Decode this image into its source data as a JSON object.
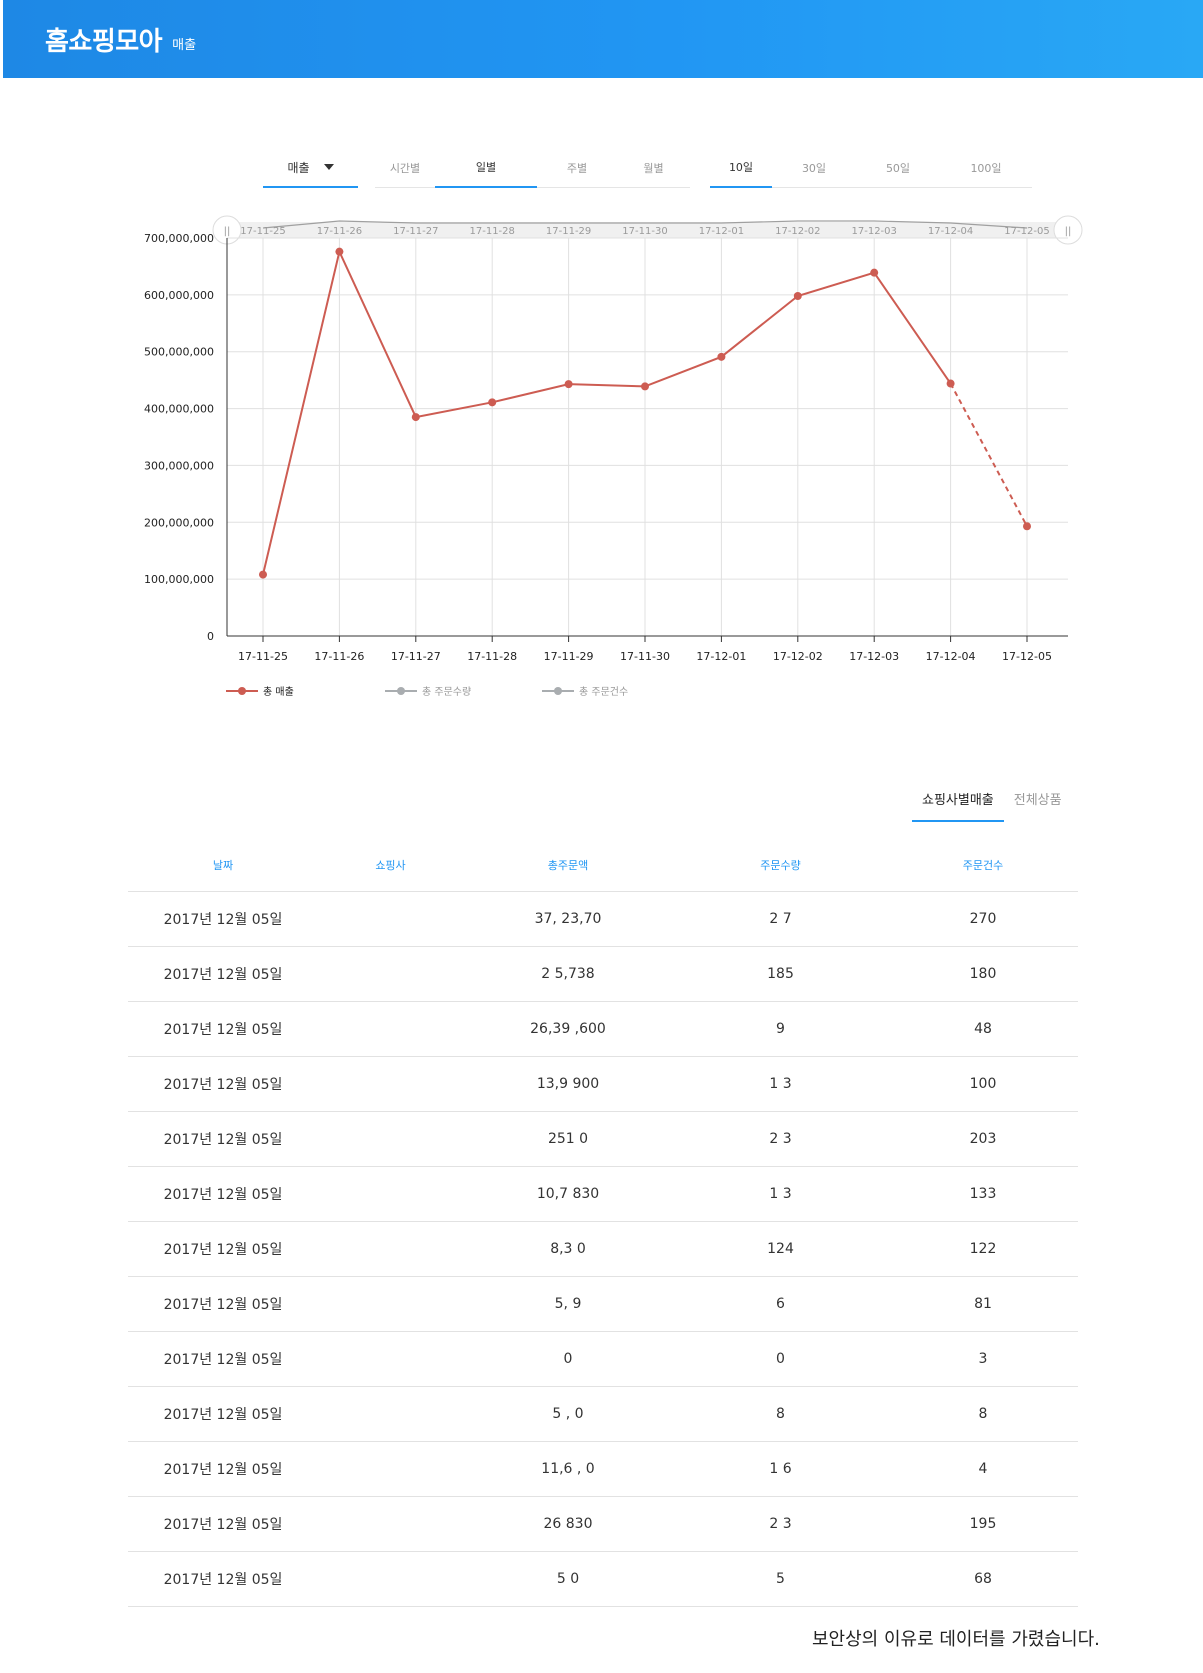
{
  "header": {
    "title": "홈쇼핑모아",
    "subtitle": "매출"
  },
  "filters": {
    "metric": "매출",
    "period_options": [
      {
        "label": "시간별",
        "active": false
      },
      {
        "label": "일별",
        "active": true
      },
      {
        "label": "주별",
        "active": false
      },
      {
        "label": "월별",
        "active": false
      }
    ],
    "range_options": [
      {
        "label": "10일",
        "active": true
      },
      {
        "label": "30일",
        "active": false
      },
      {
        "label": "50일",
        "active": false
      },
      {
        "label": "100일",
        "active": false
      }
    ]
  },
  "chart_data": {
    "type": "line",
    "categories": [
      "17-11-25",
      "17-11-26",
      "17-11-27",
      "17-11-28",
      "17-11-29",
      "17-11-30",
      "17-12-01",
      "17-12-02",
      "17-12-03",
      "17-12-04",
      "17-12-05"
    ],
    "series": [
      {
        "name": "총 매출",
        "values": [
          108000000,
          676000000,
          385000000,
          411000000,
          443000000,
          439000000,
          491000000,
          598000000,
          639000000,
          444000000,
          193000000
        ],
        "color": "#cd5c52",
        "dashed_last_segment": true
      },
      {
        "name": "총 주문수량",
        "values": [],
        "color": "#a9adb0"
      },
      {
        "name": "총 주문건수",
        "values": [],
        "color": "#a9adb0"
      }
    ],
    "yticks": [
      "0",
      "100,000,000",
      "200,000,000",
      "300,000,000",
      "400,000,000",
      "500,000,000",
      "600,000,000",
      "700,000,000"
    ],
    "ylim": [
      0,
      700000000
    ],
    "grid": true,
    "legend": "bottom-left"
  },
  "tabs": [
    {
      "label": "쇼핑사별매출",
      "active": true
    },
    {
      "label": "전체상품",
      "active": false
    }
  ],
  "table": {
    "headers": [
      "날짜",
      "쇼핑사",
      "총주문액",
      "주문수량",
      "주문건수"
    ],
    "rows": [
      [
        "2017년 12월 05일",
        "",
        "37,  23,70",
        "2 7",
        "270"
      ],
      [
        "2017년 12월 05일",
        "",
        "2    5,738",
        "185",
        "180"
      ],
      [
        "2017년 12월 05일",
        "",
        "26,39 ,600",
        "  9",
        "48"
      ],
      [
        "2017년 12월 05일",
        "",
        "13,9   900",
        "1 3",
        "100"
      ],
      [
        "2017년 12월 05일",
        "",
        "251    0",
        "2 3",
        "203"
      ],
      [
        "2017년 12월 05일",
        "",
        "10,7   830",
        "1 3",
        "133"
      ],
      [
        "2017년 12월 05일",
        "",
        "8,3    0",
        "124",
        "122"
      ],
      [
        "2017년 12월 05일",
        "",
        "5,    9",
        " 6",
        "81"
      ],
      [
        "2017년 12월 05일",
        "",
        "0",
        "0",
        "3"
      ],
      [
        "2017년 12월 05일",
        "",
        "5  ,  0",
        "8",
        "8"
      ],
      [
        "2017년 12월 05일",
        "",
        "11,6  ,  0",
        "1 6",
        "4"
      ],
      [
        "2017년 12월 05일",
        "",
        "26    830",
        "2 3",
        "195"
      ],
      [
        "2017년 12월 05일",
        "",
        "5    0",
        " 5",
        "68"
      ]
    ]
  },
  "notice": "보안상의 이유로 데이터를 가렸습니다."
}
